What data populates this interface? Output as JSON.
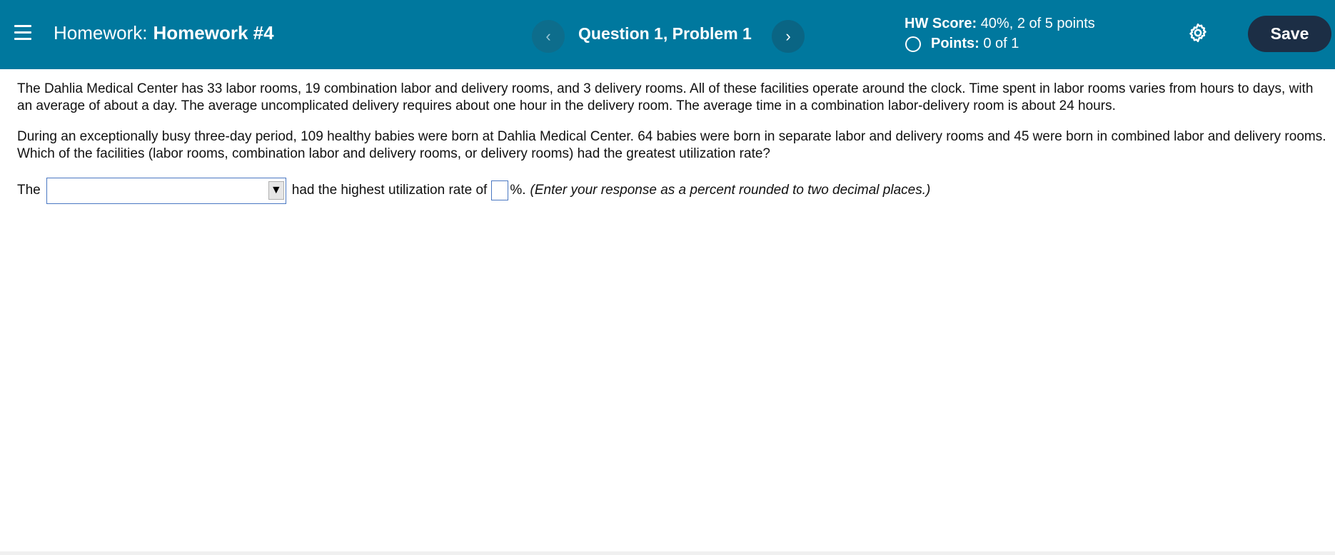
{
  "header": {
    "menu_icon": "hamburger-menu-icon",
    "title_prefix": "Homework:",
    "title_name": "Homework #4",
    "question_label": "Question 1, Problem 1",
    "prev_icon": "‹",
    "next_icon": "›",
    "hw_score_label": "HW Score:",
    "hw_score_value": "40%, 2 of 5 points",
    "points_label": "Points:",
    "points_value": "0 of 1",
    "settings_icon": "gear-icon",
    "save_label": "Save",
    "colors": {
      "bar": "#00789e",
      "save_button": "#1c2e45"
    }
  },
  "problem": {
    "paragraph1": "The Dahlia Medical Center has 33 labor rooms, 19 combination labor and delivery rooms, and 3 delivery rooms. All of these facilities operate around the clock. Time spent in labor rooms varies from hours to days, with an average of about a day. The average uncomplicated delivery requires about one hour in the delivery room. The average time in a combination labor-delivery room is about 24 hours.",
    "paragraph2": "During an exceptionally busy three-day period, 109 healthy babies were born at Dahlia Medical Center. 64 babies were born in separate labor and delivery rooms and 45 were born in combined labor and delivery rooms. Which of the facilities (labor rooms, combination labor and delivery rooms, or delivery rooms) had the greatest utilization rate?"
  },
  "answer": {
    "prefix": "The",
    "select_value": "",
    "select_arrow": "▼",
    "middle": "had the highest utilization rate of",
    "percent_value": "",
    "suffix": "%.",
    "instruction": "(Enter your response as a percent rounded to two decimal places.)"
  }
}
